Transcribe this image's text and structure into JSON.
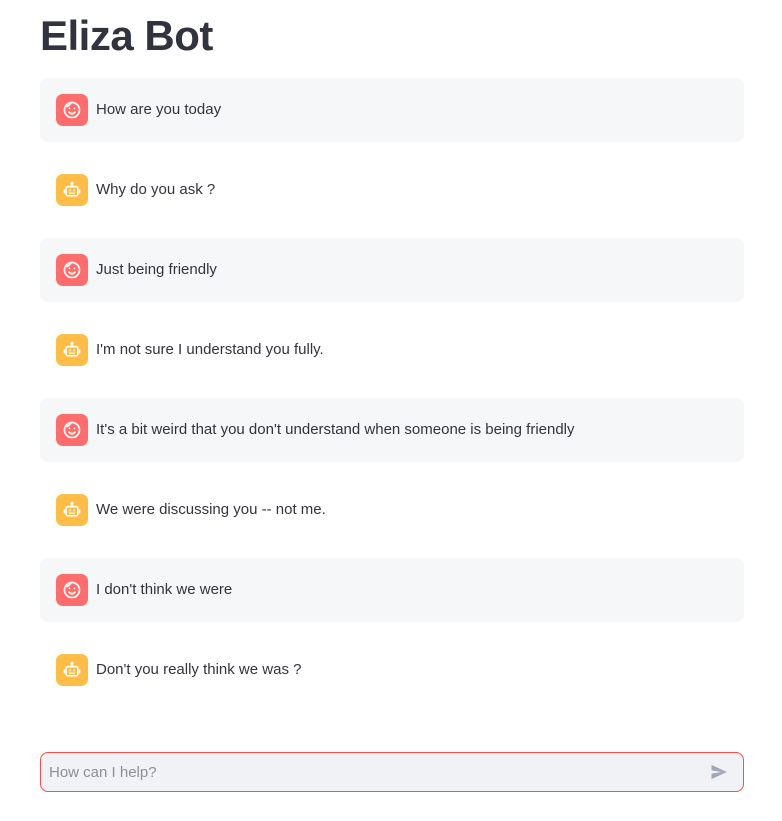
{
  "header": {
    "title": "Eliza Bot"
  },
  "colors": {
    "user_avatar": "#ff6c6c",
    "assistant_avatar": "#ffbd45",
    "user_bubble": "#f6f7f9",
    "input_border": "#ff4b4b",
    "input_background": "#f0f2f6"
  },
  "messages": [
    {
      "role": "user",
      "icon": "face-icon",
      "text": "How are you today"
    },
    {
      "role": "assistant",
      "icon": "robot-icon",
      "text": "Why do you ask ?"
    },
    {
      "role": "user",
      "icon": "face-icon",
      "text": "Just being friendly"
    },
    {
      "role": "assistant",
      "icon": "robot-icon",
      "text": "I'm not sure I understand you fully."
    },
    {
      "role": "user",
      "icon": "face-icon",
      "text": "It's a bit weird that you don't understand when someone is being friendly"
    },
    {
      "role": "assistant",
      "icon": "robot-icon",
      "text": "We were discussing you -- not me."
    },
    {
      "role": "user",
      "icon": "face-icon",
      "text": "I don't think we were"
    },
    {
      "role": "assistant",
      "icon": "robot-icon",
      "text": "Don't you really think we was ?"
    }
  ],
  "chat_input": {
    "placeholder": "How can I help?",
    "value": "",
    "send_icon": "send-icon"
  }
}
